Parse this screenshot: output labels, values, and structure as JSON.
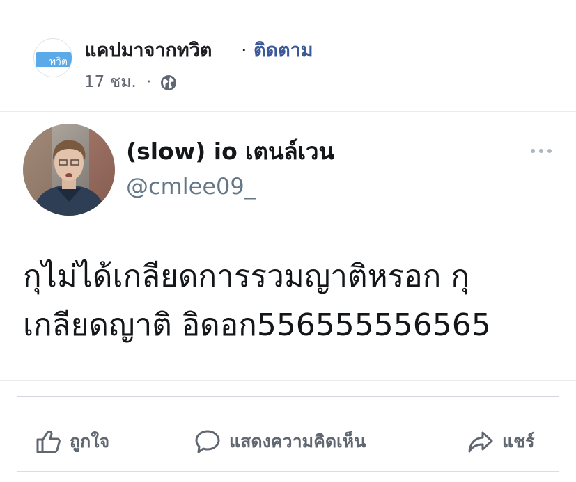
{
  "post": {
    "page_name": "แคปมาจากทวิต",
    "separator": "·",
    "follow_label": "ติดตาม",
    "time": "17 ชม.",
    "time_separator": "·",
    "privacy_icon": "globe-icon",
    "avatar": {
      "logo_text": "ทวิต",
      "logo_color": "#5aa9e8"
    }
  },
  "tweet": {
    "display_name": "(slow) io เตนล์เวน",
    "handle": "@cmlee09_",
    "text_line1": "กุไม่ได้เกลียดการรวมญาติหรอก กุ",
    "text_line2": "เกลียดญาติ อิดอก556555556565",
    "more_icon": "more-dots-icon"
  },
  "actions": {
    "like_label": "ถูกใจ",
    "comment_label": "แสดงความคิดเห็น",
    "share_label": "แชร์"
  },
  "colors": {
    "link": "#3b5998",
    "text": "#1c1e21",
    "secondary": "#616770",
    "twitter_handle": "#657786"
  }
}
